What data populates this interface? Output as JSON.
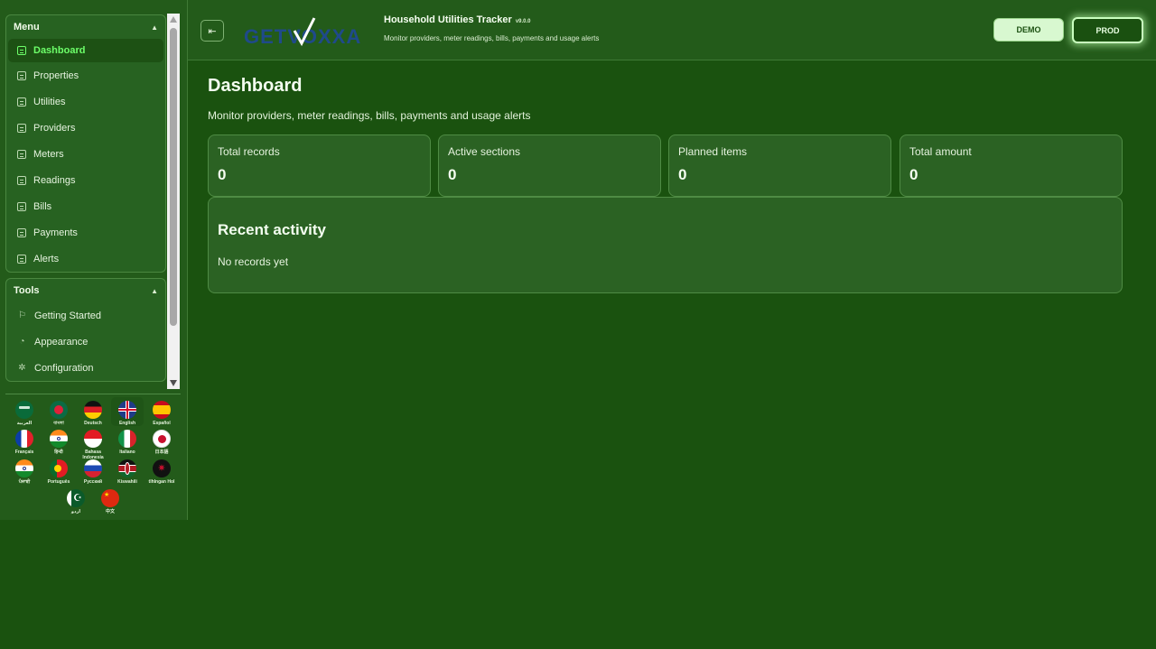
{
  "sidebar": {
    "menu": {
      "title": "Menu",
      "items": [
        {
          "label": "Dashboard"
        },
        {
          "label": "Properties"
        },
        {
          "label": "Utilities"
        },
        {
          "label": "Providers"
        },
        {
          "label": "Meters"
        },
        {
          "label": "Readings"
        },
        {
          "label": "Bills"
        },
        {
          "label": "Payments"
        },
        {
          "label": "Alerts"
        }
      ]
    },
    "tools": {
      "title": "Tools",
      "items": [
        {
          "label": "Getting Started",
          "icon": "flag-outline-icon"
        },
        {
          "label": "Appearance",
          "icon": "palette-icon"
        },
        {
          "label": "Configuration",
          "icon": "gear-icon"
        }
      ]
    },
    "languages": [
      {
        "label": "العربية"
      },
      {
        "label": "বাংলা"
      },
      {
        "label": "Deutsch"
      },
      {
        "label": "English"
      },
      {
        "label": "Español"
      },
      {
        "label": "Français"
      },
      {
        "label": "हिन्दी"
      },
      {
        "label": "Bahasa Indonesia"
      },
      {
        "label": "Italiano"
      },
      {
        "label": "日本語"
      },
      {
        "label": "ਪੰਜਾਬੀ"
      },
      {
        "label": "Português"
      },
      {
        "label": "Русский"
      },
      {
        "label": "Kiswahili"
      },
      {
        "label": "tlhIngan Hol"
      },
      {
        "label": "اردو"
      },
      {
        "label": "中文"
      }
    ]
  },
  "header": {
    "logo_text": "GETVOXXA",
    "title": "Household Utilities Tracker",
    "version": "v9.0.0",
    "subtitle": "Monitor providers, meter readings, bills, payments and usage alerts",
    "demo_label": "DEMO",
    "prod_label": "PROD"
  },
  "main": {
    "title": "Dashboard",
    "subtitle": "Monitor providers, meter readings, bills, payments and usage alerts",
    "cards": [
      {
        "label": "Total records",
        "value": "0"
      },
      {
        "label": "Active sections",
        "value": "0"
      },
      {
        "label": "Planned items",
        "value": "0"
      },
      {
        "label": "Total amount",
        "value": "0"
      }
    ],
    "activity": {
      "title": "Recent activity",
      "empty": "No records yet"
    }
  },
  "colors": {
    "background": "#1a520f",
    "panel": "#235b1a",
    "accent": "#6dff6a"
  }
}
